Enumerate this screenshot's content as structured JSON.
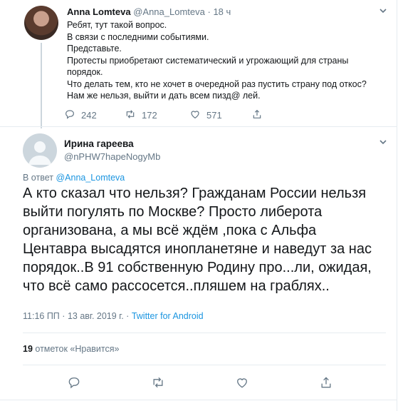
{
  "parent_tweet": {
    "display_name": "Anna Lomteva",
    "handle": "@Anna_Lomteva",
    "dot": "·",
    "time": "18 ч",
    "lines": [
      "Ребят, тут такой вопрос.",
      "В связи с последними событиями.",
      "Представьте.",
      "Протесты приобретают систематический и угрожающий для страны",
      "порядок.",
      "Что делать тем, кто не хочет в очередной раз пустить страну под откос?",
      "Нам же нельзя, выйти и дать всем пизд@ лей."
    ],
    "reply_count": "242",
    "retweet_count": "172",
    "like_count": "571"
  },
  "main_tweet": {
    "display_name": "Ирина гареева",
    "handle": "@nPHW7hapeNogyMb",
    "reply_prefix": "В ответ",
    "reply_handle": "@Anna_Lomteva",
    "lines": [
      "А кто сказал что нельзя? Гражданам России нельзя",
      "выйти погулять по Москве? Просто либерота",
      "организована, а мы всё ждём ,пока с Альфа",
      "Центавра высадятся инопланетяне и наведут за нас",
      "порядок..В 91 собственную Родину про...ли, ожидая,",
      "что всё само рассосется..пляшем на граблях.."
    ],
    "time": "11:16 ПП",
    "date_sep": "·",
    "date": "13 авг. 2019 г.",
    "source_sep": "·",
    "source": "Twitter for Android",
    "like_count": "19",
    "like_label": "отметок «Нравится»"
  },
  "icons": [
    "chevron-down-icon",
    "reply-icon",
    "retweet-icon",
    "like-icon",
    "share-icon",
    "default-avatar-icon"
  ],
  "colors": {
    "link": "#1b95e0",
    "muted": "#657786",
    "text": "#14171a",
    "divider": "#e6ecf0"
  }
}
